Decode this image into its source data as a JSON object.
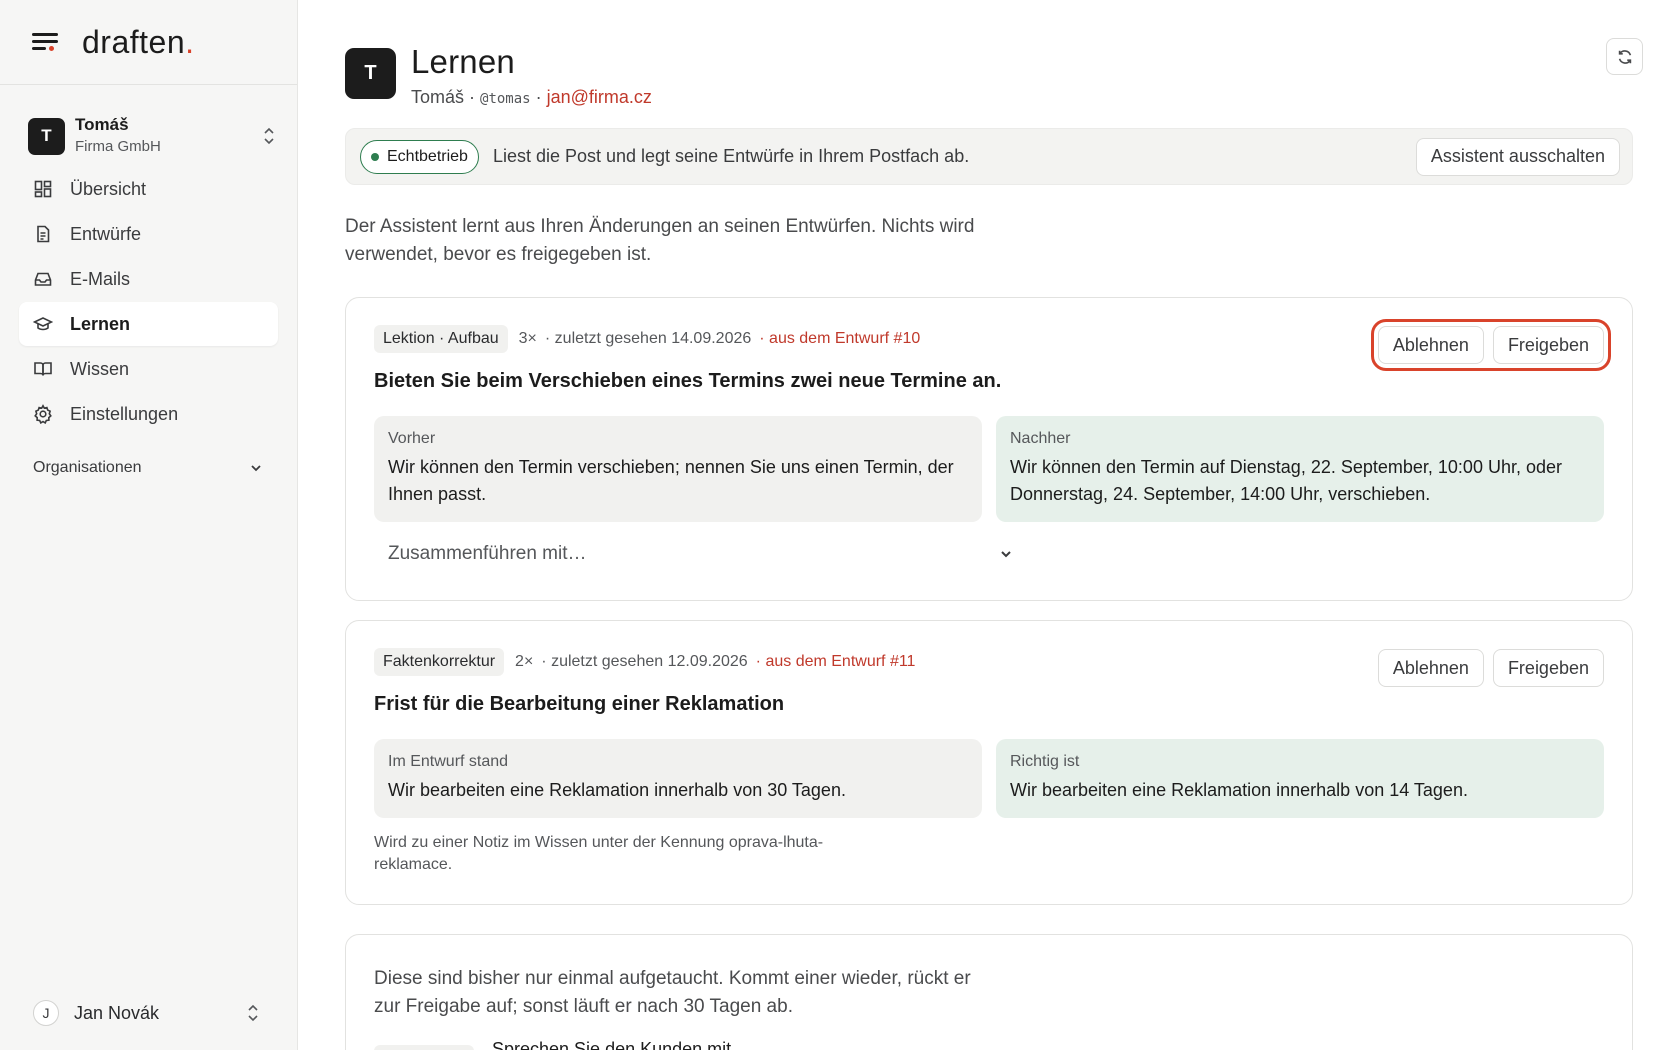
{
  "brand": {
    "logo_text": "draften",
    "logo_dot": "."
  },
  "org": {
    "avatar": "T",
    "name": "Tomáš",
    "company": "Firma GmbH"
  },
  "nav": {
    "items": [
      {
        "label": "Übersicht",
        "icon": "grid-icon"
      },
      {
        "label": "Entwürfe",
        "icon": "document-icon"
      },
      {
        "label": "E-Mails",
        "icon": "inbox-icon"
      },
      {
        "label": "Lernen",
        "icon": "graduation-cap-icon",
        "active": true
      },
      {
        "label": "Wissen",
        "icon": "book-icon"
      },
      {
        "label": "Einstellungen",
        "icon": "gear-icon"
      }
    ],
    "group_label": "Organisationen"
  },
  "user": {
    "avatar": "J",
    "name": "Jan Novák"
  },
  "page": {
    "avatar": "T",
    "title": "Lernen",
    "sub_name": "Tomáš",
    "sub_sep1": " · ",
    "sub_handle": "@tomas",
    "sub_sep2": " · ",
    "sub_email": "jan@firma.cz"
  },
  "status": {
    "badge": "Echtbetrieb",
    "text": "Liest die Post und legt seine Entwürfe in Ihrem Postfach ab.",
    "button": "Assistent ausschalten"
  },
  "intro": "Der Assistent lernt aus Ihren Änderungen an seinen Entwürfen. Nichts wird verwendet, bevor es freigegeben ist.",
  "cards": [
    {
      "tag": "Lektion · Aufbau",
      "count": "3×",
      "seen": "· zuletzt gesehen 14.09.2026",
      "source": "· aus dem Entwurf #10",
      "reject": "Ablehnen",
      "approve": "Freigeben",
      "title": "Bieten Sie beim Verschieben eines Termins zwei neue Termine an.",
      "before_label": "Vorher",
      "before_text": "Wir können den Termin verschieben; nennen Sie uns einen Termin, der Ihnen passt.",
      "after_label": "Nachher",
      "after_text": "Wir können den Termin auf Dienstag, 22. September, 10:00 Uhr, oder Donnerstag, 24. September, 14:00 Uhr, verschieben.",
      "merge_placeholder": "Zusammenführen mit…"
    },
    {
      "tag": "Faktenkorrektur",
      "count": "2×",
      "seen": "· zuletzt gesehen 12.09.2026",
      "source": "· aus dem Entwurf #11",
      "reject": "Ablehnen",
      "approve": "Freigeben",
      "title": "Frist für die Bearbeitung einer Reklamation",
      "before_label": "Im Entwurf stand",
      "before_text": "Wir bearbeiten eine Reklamation innerhalb von 30 Tagen.",
      "after_label": "Richtig ist",
      "after_text": "Wir bearbeiten eine Reklamation innerhalb von 14 Tagen.",
      "note": "Wird zu einer Notiz im Wissen unter der Kennung oprava-lhuta-reklamace."
    }
  ],
  "pending": {
    "text": "Diese sind bisher nur einmal aufgetaucht. Kommt einer wieder, rückt er zur Freigabe auf; sonst läuft er nach 30 Tagen ab.",
    "next_item": "Sprechen Sie den Kunden mit"
  },
  "colors": {
    "accent": "#d9432b",
    "live": "#2e7d4f",
    "after_bg": "#e6f0ea"
  }
}
